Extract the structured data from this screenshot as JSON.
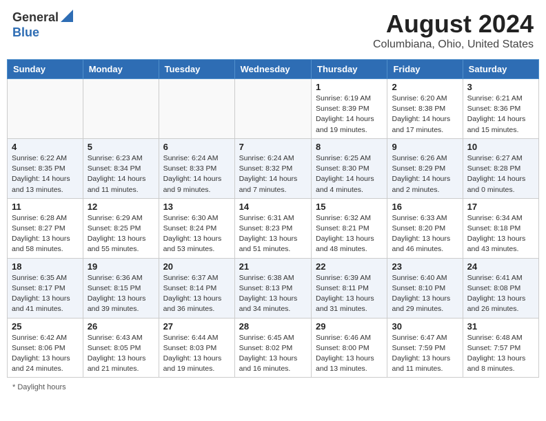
{
  "header": {
    "logo_general": "General",
    "logo_blue": "Blue",
    "title": "August 2024",
    "subtitle": "Columbiana, Ohio, United States"
  },
  "days_of_week": [
    "Sunday",
    "Monday",
    "Tuesday",
    "Wednesday",
    "Thursday",
    "Friday",
    "Saturday"
  ],
  "footer": {
    "daylight_label": "Daylight hours"
  },
  "weeks": [
    [
      {
        "day": "",
        "info": "",
        "empty": true
      },
      {
        "day": "",
        "info": "",
        "empty": true
      },
      {
        "day": "",
        "info": "",
        "empty": true
      },
      {
        "day": "",
        "info": "",
        "empty": true
      },
      {
        "day": "1",
        "info": "Sunrise: 6:19 AM\nSunset: 8:39 PM\nDaylight: 14 hours\nand 19 minutes.",
        "empty": false
      },
      {
        "day": "2",
        "info": "Sunrise: 6:20 AM\nSunset: 8:38 PM\nDaylight: 14 hours\nand 17 minutes.",
        "empty": false
      },
      {
        "day": "3",
        "info": "Sunrise: 6:21 AM\nSunset: 8:36 PM\nDaylight: 14 hours\nand 15 minutes.",
        "empty": false
      }
    ],
    [
      {
        "day": "4",
        "info": "Sunrise: 6:22 AM\nSunset: 8:35 PM\nDaylight: 14 hours\nand 13 minutes.",
        "empty": false
      },
      {
        "day": "5",
        "info": "Sunrise: 6:23 AM\nSunset: 8:34 PM\nDaylight: 14 hours\nand 11 minutes.",
        "empty": false
      },
      {
        "day": "6",
        "info": "Sunrise: 6:24 AM\nSunset: 8:33 PM\nDaylight: 14 hours\nand 9 minutes.",
        "empty": false
      },
      {
        "day": "7",
        "info": "Sunrise: 6:24 AM\nSunset: 8:32 PM\nDaylight: 14 hours\nand 7 minutes.",
        "empty": false
      },
      {
        "day": "8",
        "info": "Sunrise: 6:25 AM\nSunset: 8:30 PM\nDaylight: 14 hours\nand 4 minutes.",
        "empty": false
      },
      {
        "day": "9",
        "info": "Sunrise: 6:26 AM\nSunset: 8:29 PM\nDaylight: 14 hours\nand 2 minutes.",
        "empty": false
      },
      {
        "day": "10",
        "info": "Sunrise: 6:27 AM\nSunset: 8:28 PM\nDaylight: 14 hours\nand 0 minutes.",
        "empty": false
      }
    ],
    [
      {
        "day": "11",
        "info": "Sunrise: 6:28 AM\nSunset: 8:27 PM\nDaylight: 13 hours\nand 58 minutes.",
        "empty": false
      },
      {
        "day": "12",
        "info": "Sunrise: 6:29 AM\nSunset: 8:25 PM\nDaylight: 13 hours\nand 55 minutes.",
        "empty": false
      },
      {
        "day": "13",
        "info": "Sunrise: 6:30 AM\nSunset: 8:24 PM\nDaylight: 13 hours\nand 53 minutes.",
        "empty": false
      },
      {
        "day": "14",
        "info": "Sunrise: 6:31 AM\nSunset: 8:23 PM\nDaylight: 13 hours\nand 51 minutes.",
        "empty": false
      },
      {
        "day": "15",
        "info": "Sunrise: 6:32 AM\nSunset: 8:21 PM\nDaylight: 13 hours\nand 48 minutes.",
        "empty": false
      },
      {
        "day": "16",
        "info": "Sunrise: 6:33 AM\nSunset: 8:20 PM\nDaylight: 13 hours\nand 46 minutes.",
        "empty": false
      },
      {
        "day": "17",
        "info": "Sunrise: 6:34 AM\nSunset: 8:18 PM\nDaylight: 13 hours\nand 43 minutes.",
        "empty": false
      }
    ],
    [
      {
        "day": "18",
        "info": "Sunrise: 6:35 AM\nSunset: 8:17 PM\nDaylight: 13 hours\nand 41 minutes.",
        "empty": false
      },
      {
        "day": "19",
        "info": "Sunrise: 6:36 AM\nSunset: 8:15 PM\nDaylight: 13 hours\nand 39 minutes.",
        "empty": false
      },
      {
        "day": "20",
        "info": "Sunrise: 6:37 AM\nSunset: 8:14 PM\nDaylight: 13 hours\nand 36 minutes.",
        "empty": false
      },
      {
        "day": "21",
        "info": "Sunrise: 6:38 AM\nSunset: 8:13 PM\nDaylight: 13 hours\nand 34 minutes.",
        "empty": false
      },
      {
        "day": "22",
        "info": "Sunrise: 6:39 AM\nSunset: 8:11 PM\nDaylight: 13 hours\nand 31 minutes.",
        "empty": false
      },
      {
        "day": "23",
        "info": "Sunrise: 6:40 AM\nSunset: 8:10 PM\nDaylight: 13 hours\nand 29 minutes.",
        "empty": false
      },
      {
        "day": "24",
        "info": "Sunrise: 6:41 AM\nSunset: 8:08 PM\nDaylight: 13 hours\nand 26 minutes.",
        "empty": false
      }
    ],
    [
      {
        "day": "25",
        "info": "Sunrise: 6:42 AM\nSunset: 8:06 PM\nDaylight: 13 hours\nand 24 minutes.",
        "empty": false
      },
      {
        "day": "26",
        "info": "Sunrise: 6:43 AM\nSunset: 8:05 PM\nDaylight: 13 hours\nand 21 minutes.",
        "empty": false
      },
      {
        "day": "27",
        "info": "Sunrise: 6:44 AM\nSunset: 8:03 PM\nDaylight: 13 hours\nand 19 minutes.",
        "empty": false
      },
      {
        "day": "28",
        "info": "Sunrise: 6:45 AM\nSunset: 8:02 PM\nDaylight: 13 hours\nand 16 minutes.",
        "empty": false
      },
      {
        "day": "29",
        "info": "Sunrise: 6:46 AM\nSunset: 8:00 PM\nDaylight: 13 hours\nand 13 minutes.",
        "empty": false
      },
      {
        "day": "30",
        "info": "Sunrise: 6:47 AM\nSunset: 7:59 PM\nDaylight: 13 hours\nand 11 minutes.",
        "empty": false
      },
      {
        "day": "31",
        "info": "Sunrise: 6:48 AM\nSunset: 7:57 PM\nDaylight: 13 hours\nand 8 minutes.",
        "empty": false
      }
    ]
  ]
}
